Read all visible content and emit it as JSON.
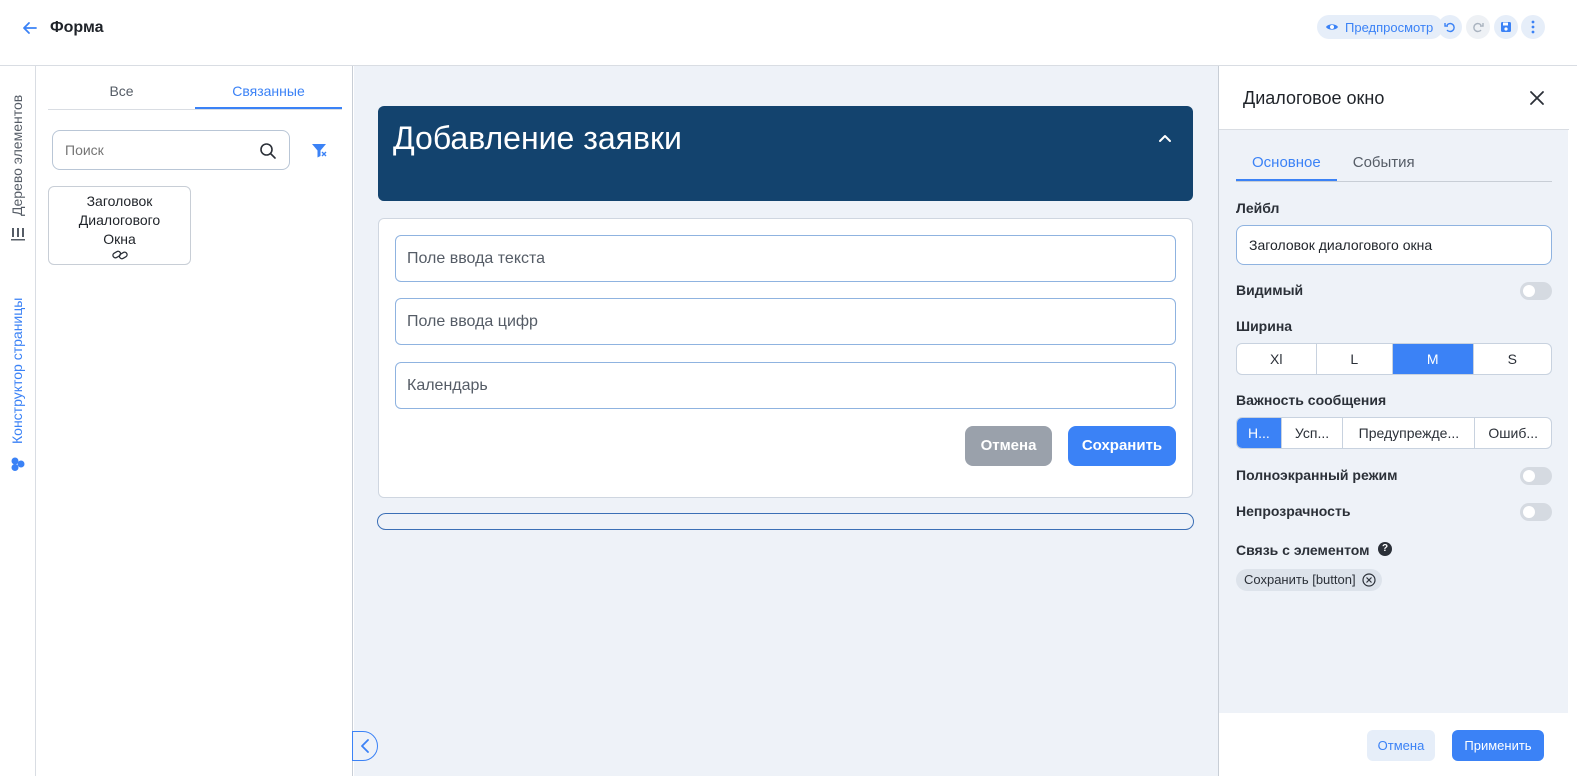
{
  "header": {
    "title": "Форма",
    "preview_label": "Предпросмотр"
  },
  "rail": {
    "tree_label": "Дерево элементов",
    "builder_label": "Конструктор страницы"
  },
  "left_panel": {
    "tabs": [
      {
        "label": "Все",
        "active": false
      },
      {
        "label": "Связанные",
        "active": true
      }
    ],
    "search_placeholder": "Поиск",
    "card_label": "Заголовок Диалогового Окна"
  },
  "canvas": {
    "dialog_title": "Добавление заявки",
    "fields": [
      "Поле ввода текста",
      "Поле ввода цифр",
      "Календарь"
    ],
    "cancel_label": "Отмена",
    "save_label": "Сохранить"
  },
  "right_panel": {
    "title": "Диалоговое окно",
    "tabs": [
      {
        "label": "Основное",
        "active": true
      },
      {
        "label": "События",
        "active": false
      }
    ],
    "label_field_title": "Лейбл",
    "label_field_value": "Заголовок диалогового окна",
    "visible_label": "Видимый",
    "width_label": "Ширина",
    "width_options": [
      "Xl",
      "L",
      "M",
      "S"
    ],
    "width_selected": "M",
    "importance_label": "Важность сообщения",
    "importance_options": [
      "Н...",
      "Усп...",
      "Предупрежде...",
      "Ошиб..."
    ],
    "importance_selected": "Н...",
    "fullscreen_label": "Полноэкранный режим",
    "opacity_label": "Непрозрачность",
    "link_label": "Связь с элементом",
    "link_chip": "Сохранить [button]",
    "cancel_label": "Отмена",
    "apply_label": "Применить"
  },
  "colors": {
    "accent": "#3b82f6",
    "dialog_header": "#13436e",
    "canvas_bg": "#eef2f8"
  }
}
